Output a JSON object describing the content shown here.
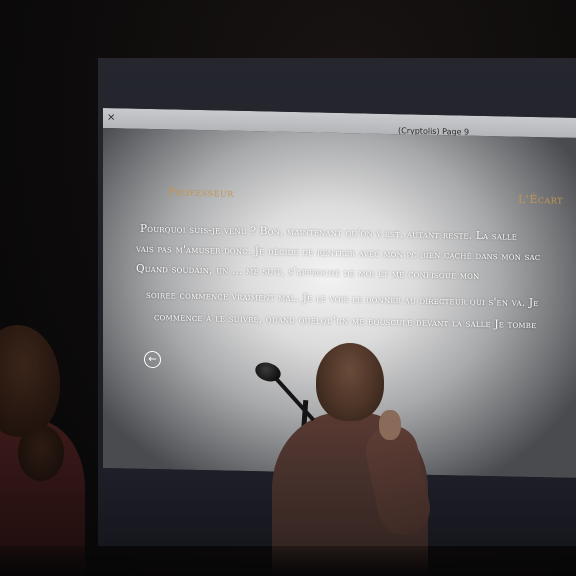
{
  "window": {
    "close_glyph": "×",
    "title": "(Cryptolis) Page 9"
  },
  "speakers": {
    "left": "Professeur",
    "right": "L'Écart"
  },
  "story": {
    "line1": "Pourquoi suis-je venu ? Bon, maintenant qu'on y est, autant reste. La salle",
    "line2": "vais pas m'amuser donc. Je décide de rentrer avec mon pc bien caché dans mon sac",
    "line3": "Quand soudain, un ... me suit, s'approche de moi et me confisque mon",
    "line4": "soirée commence vraiment mal. Je le vois le donner au directeur qui s'en va. Je",
    "line5": "commence à le suivre, quand quelqu'un me bouscule devant la salle Je tombe"
  },
  "controls": {
    "back_glyph": "←"
  },
  "colors": {
    "speaker_name": "#c3964e",
    "story_text": "#ffffff",
    "titlebar": "#c4c5c8",
    "backdrop": "#0b0909"
  }
}
